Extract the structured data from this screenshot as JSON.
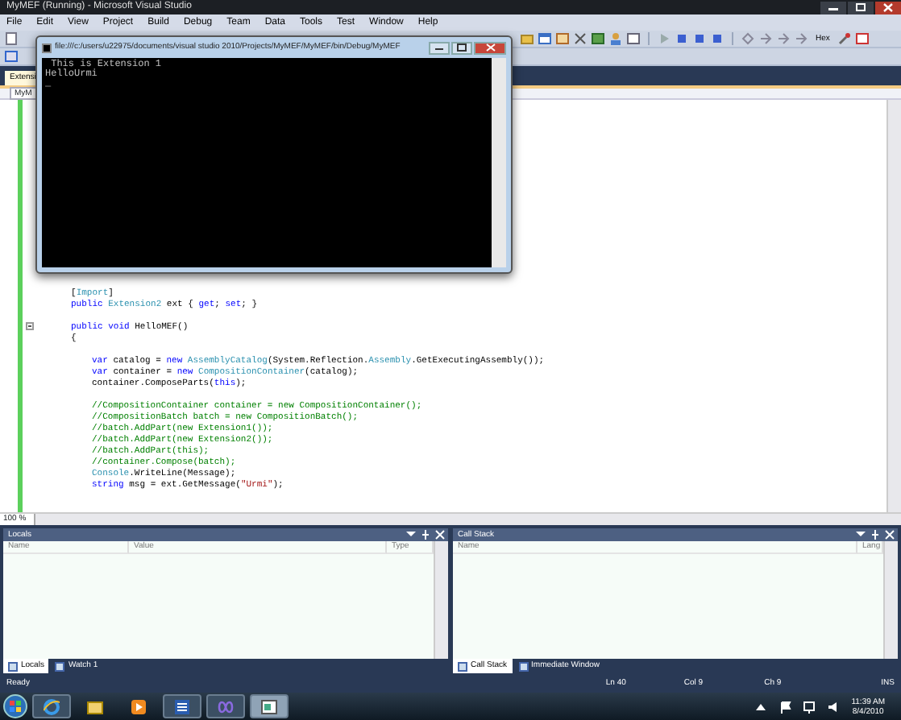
{
  "window": {
    "title": "MyMEF (Running) - Microsoft Visual Studio"
  },
  "menu": [
    "File",
    "Edit",
    "View",
    "Project",
    "Build",
    "Debug",
    "Team",
    "Data",
    "Tools",
    "Test",
    "Window",
    "Help"
  ],
  "toolbar": {
    "hex_label": "Hex"
  },
  "document_tabs": [
    {
      "label": "Extensi",
      "selected": true
    }
  ],
  "navigation_bar": {
    "type_dropdown": "MyM"
  },
  "editor": {
    "zoom": "100 %",
    "code_blocks": [
      [
        {
          "collapsible": false,
          "tokens": [
            {
              "kind": "plain",
              "text": "["
            },
            {
              "kind": "type",
              "text": "Import"
            },
            {
              "kind": "plain",
              "text": "]"
            }
          ]
        },
        {
          "collapsible": false,
          "tokens": [
            {
              "kind": "keyword",
              "text": "public "
            },
            {
              "kind": "type",
              "text": "Extension2"
            },
            {
              "kind": "plain",
              "text": " ext { "
            },
            {
              "kind": "keyword",
              "text": "get"
            },
            {
              "kind": "plain",
              "text": "; "
            },
            {
              "kind": "keyword",
              "text": "set"
            },
            {
              "kind": "plain",
              "text": "; }"
            }
          ]
        }
      ],
      [
        {
          "collapsible": true,
          "tokens": [
            {
              "kind": "keyword",
              "text": "public void"
            },
            {
              "kind": "plain",
              "text": " HelloMEF()"
            }
          ]
        },
        {
          "collapsible": false,
          "tokens": [
            {
              "kind": "plain",
              "text": "{"
            }
          ]
        }
      ],
      [
        {
          "collapsible": false,
          "indented": true,
          "tokens": [
            {
              "kind": "keyword",
              "text": "var"
            },
            {
              "kind": "plain",
              "text": " catalog = "
            },
            {
              "kind": "keyword",
              "text": "new "
            },
            {
              "kind": "type",
              "text": "AssemblyCatalog"
            },
            {
              "kind": "plain",
              "text": "(System.Reflection."
            },
            {
              "kind": "type",
              "text": "Assembly"
            },
            {
              "kind": "plain",
              "text": ".GetExecutingAssembly());"
            }
          ]
        },
        {
          "collapsible": false,
          "indented": true,
          "tokens": [
            {
              "kind": "keyword",
              "text": "var"
            },
            {
              "kind": "plain",
              "text": " container = "
            },
            {
              "kind": "keyword",
              "text": "new "
            },
            {
              "kind": "type",
              "text": "CompositionContainer"
            },
            {
              "kind": "plain",
              "text": "(catalog);"
            }
          ]
        },
        {
          "collapsible": false,
          "indented": true,
          "tokens": [
            {
              "kind": "plain",
              "text": "container.ComposeParts("
            },
            {
              "kind": "keyword",
              "text": "this"
            },
            {
              "kind": "plain",
              "text": ");"
            }
          ]
        }
      ],
      [
        {
          "collapsible": false,
          "indented": true,
          "tokens": [
            {
              "kind": "comment",
              "text": "//CompositionContainer container = new CompositionContainer();"
            }
          ]
        },
        {
          "collapsible": false,
          "indented": true,
          "tokens": [
            {
              "kind": "comment",
              "text": "//CompositionBatch batch = new CompositionBatch();"
            }
          ]
        },
        {
          "collapsible": false,
          "indented": true,
          "tokens": [
            {
              "kind": "comment",
              "text": "//batch.AddPart(new Extension1());"
            }
          ]
        },
        {
          "collapsible": false,
          "indented": true,
          "tokens": [
            {
              "kind": "comment",
              "text": "//batch.AddPart(new Extension2());"
            }
          ]
        },
        {
          "collapsible": false,
          "indented": true,
          "tokens": [
            {
              "kind": "comment",
              "text": "//batch.AddPart(this);"
            }
          ]
        },
        {
          "collapsible": false,
          "indented": true,
          "tokens": [
            {
              "kind": "comment",
              "text": "//container.Compose(batch);"
            }
          ]
        },
        {
          "collapsible": false,
          "indented": true,
          "tokens": [
            {
              "kind": "type",
              "text": "Console"
            },
            {
              "kind": "plain",
              "text": ".WriteLine(Message);"
            }
          ]
        },
        {
          "collapsible": false,
          "indented": true,
          "tokens": [
            {
              "kind": "keyword",
              "text": "string"
            },
            {
              "kind": "plain",
              "text": " msg = ext.GetMessage("
            },
            {
              "kind": "string",
              "text": "\"Urmi\""
            },
            {
              "kind": "plain",
              "text": ");"
            }
          ]
        }
      ]
    ]
  },
  "panels": [
    {
      "title": "Locals",
      "columns": [
        "Name",
        "Value",
        "Type"
      ],
      "tabs": [
        {
          "label": "Locals",
          "selected": true
        },
        {
          "label": "Watch 1",
          "selected": false
        }
      ]
    },
    {
      "title": "Call Stack",
      "columns": [
        "Name",
        "Lang"
      ],
      "tabs": [
        {
          "label": "Call Stack",
          "selected": true
        },
        {
          "label": "Immediate Window",
          "selected": false
        }
      ]
    }
  ],
  "status_bar": {
    "text": "Ready",
    "line": "Ln 40",
    "column": "Col 9",
    "char": "Ch 9",
    "mode": "INS"
  },
  "taskbar": {
    "buttons": [
      {
        "kind": "browser",
        "running": true,
        "selected": false
      },
      {
        "kind": "folder",
        "running": false,
        "selected": false
      },
      {
        "kind": "media",
        "running": false,
        "selected": false
      },
      {
        "kind": "word",
        "running": true,
        "selected": false
      },
      {
        "kind": "studio",
        "running": true,
        "selected": false
      },
      {
        "kind": "console",
        "running": true,
        "selected": true
      }
    ],
    "time": "11:39 AM",
    "date": "8/4/2010"
  },
  "console": {
    "title": "file:///c:/users/u22975/documents/visual studio 2010/Projects/MyMEF/MyMEF/bin/Debug/MyMEF",
    "lines": [
      " This is Extension 1",
      "HelloUrmi",
      "_"
    ]
  }
}
